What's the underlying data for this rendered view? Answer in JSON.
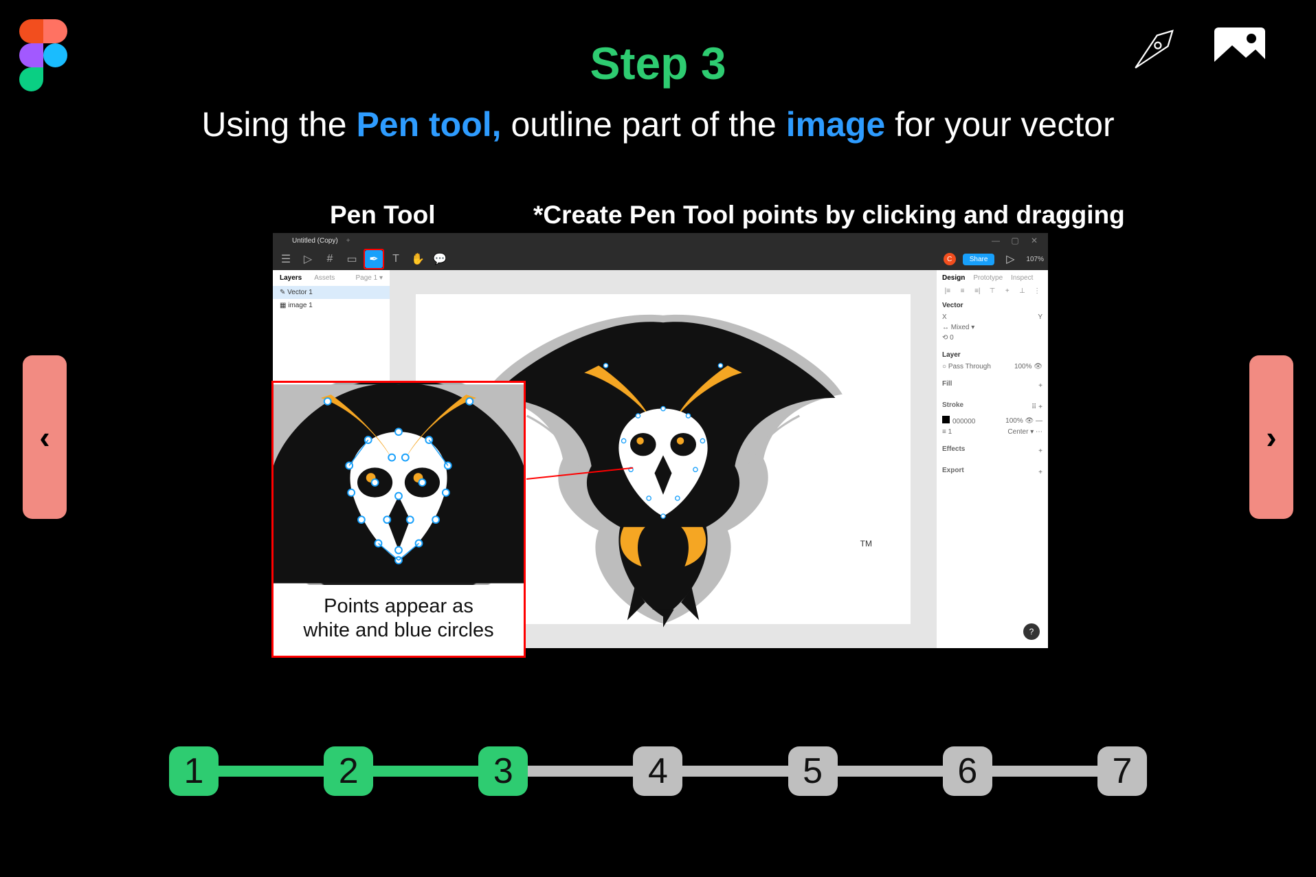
{
  "header": {
    "title": "Step 3",
    "subtitle_pre": "Using the ",
    "subtitle_kw1": "Pen tool,",
    "subtitle_mid": " outline part of the ",
    "subtitle_kw2": "image",
    "subtitle_post": " for your vector"
  },
  "labels": {
    "pen_tool": "Pen Tool",
    "tip": "*Create Pen Tool points by clicking and dragging"
  },
  "callout": {
    "line1": "Points appear as",
    "line2": "white and blue circles"
  },
  "figma_shot": {
    "file_name": "Untitled (Copy)",
    "share": "Share",
    "zoom": "107%",
    "avatar": "C",
    "left_panel": {
      "tabs": [
        "Layers",
        "Assets"
      ],
      "page": "Page 1",
      "layers": [
        "Vector 1",
        "image 1"
      ]
    },
    "right_panel": {
      "tabs": [
        "Design",
        "Prototype",
        "Inspect"
      ],
      "section_vector": "Vector",
      "coord_x": "X",
      "coord_y": "Y",
      "mixed": "Mixed",
      "rotate": "0",
      "section_layer": "Layer",
      "blend": "Pass Through",
      "blend_pct": "100%",
      "section_fill": "Fill",
      "section_stroke": "Stroke",
      "stroke_hex": "000000",
      "stroke_pct": "100%",
      "stroke_w": "1",
      "stroke_align": "Center",
      "section_effects": "Effects",
      "section_export": "Export"
    },
    "trademark": "TM"
  },
  "nav": {
    "prev": "‹",
    "next": "›"
  },
  "stepper": {
    "total": 7,
    "current": 3,
    "steps": [
      "1",
      "2",
      "3",
      "4",
      "5",
      "6",
      "7"
    ]
  }
}
